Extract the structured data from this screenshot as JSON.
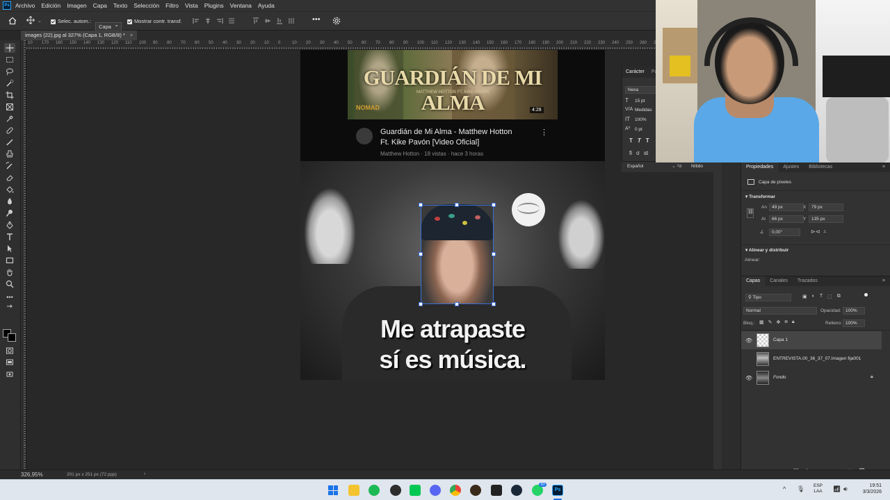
{
  "menu": [
    "Archivo",
    "Edición",
    "Imagen",
    "Capa",
    "Texto",
    "Selección",
    "Filtro",
    "Vista",
    "Plugins",
    "Ventana",
    "Ayuda"
  ],
  "app_logo": "Ps",
  "options": {
    "auto_select_label": "Selec. autom.:",
    "auto_select_value": "Capa",
    "show_transform_label": "Mostrar contr. transf."
  },
  "document": {
    "tab_title": "images (22).jpg al 327% (Capa 1, RGB/8) *",
    "close_symbol": "×",
    "zoom": "326,95%",
    "doc_info": "201 px x 251 px (72 ppp)"
  },
  "ruler_marks": [
    "10",
    "170",
    "160",
    "150",
    "140",
    "130",
    "120",
    "110",
    "100",
    "90",
    "80",
    "70",
    "60",
    "50",
    "40",
    "30",
    "20",
    "10",
    "0",
    "10",
    "20",
    "30",
    "40",
    "50",
    "60",
    "70",
    "80",
    "90",
    "100",
    "110",
    "120",
    "130",
    "140",
    "150",
    "160",
    "170",
    "180",
    "190",
    "200",
    "210",
    "220",
    "230",
    "240",
    "250",
    "260",
    "270",
    "280"
  ],
  "canvas_image": {
    "video_title_overlay": "GUARDIÁN DE MI ALMA",
    "video_subtitle_overlay": "MATTHEW HOTTON FT. KIKE PAVÓN",
    "video_corner_logo": "NOMAD",
    "video_duration": "4:28",
    "video_title_line1": "Guardián de Mi Alma - Matthew Hotton",
    "video_title_line2": "Ft. Kike Pavón [Video Oficial]",
    "video_meta": "Matthew Hotton · 18 vistas · hace 3 horas",
    "meme_line1": "Me atrapaste",
    "meme_line2": "sí es música."
  },
  "character_panel": {
    "tab_label": "Carácter",
    "tab2_label": "Pá",
    "font_family": "Nexa",
    "font_size": "15 pt",
    "kerning": "Medidas",
    "vertical_scale": "100%",
    "baseline_shift": "0 pt",
    "language": "Español",
    "antialias": "Nítido"
  },
  "properties": {
    "tabs": [
      "Propiedades",
      "Ajustes",
      "Bibliotecas"
    ],
    "layer_kind": "Capa de píxeles",
    "transform_title": "Transformar",
    "width_label": "An",
    "width_value": "49 px",
    "height_label": "Al",
    "height_value": "66 px",
    "x_label": "X",
    "x_value": "79 px",
    "y_label": "Y",
    "y_value": "135 px",
    "angle_value": "0,00°",
    "align_title": "Alinear y distribuir",
    "align_label": "Alinear:"
  },
  "layers_panel": {
    "tabs": [
      "Capas",
      "Canales",
      "Trazados"
    ],
    "filter_value": "Tipo",
    "blend_mode": "Normal",
    "opacity_label": "Opacidad:",
    "opacity_value": "100%",
    "lock_label": "Bloq.:",
    "fill_label": "Relleno:",
    "fill_value": "100%",
    "layers": [
      {
        "name": "Capa 1",
        "visible": true,
        "selected": true,
        "italic": false
      },
      {
        "name": "ENTREVISTA.00_36_37_07.Imagen fija001",
        "visible": false,
        "selected": false,
        "italic": false
      },
      {
        "name": "Fondo",
        "visible": true,
        "selected": false,
        "italic": true
      }
    ]
  },
  "taskbar": {
    "lang_line1": "ESP",
    "lang_line2": "LAA",
    "time": "19:51",
    "date": "3/3/2026",
    "whatsapp_badge": "30"
  },
  "colors": {
    "accent": "#31a8ff",
    "panel_bg": "#323232",
    "canvas_bg": "#282828",
    "selection_handle": "#3a6fd8",
    "taskbar_bg": "#dfe6ee"
  }
}
